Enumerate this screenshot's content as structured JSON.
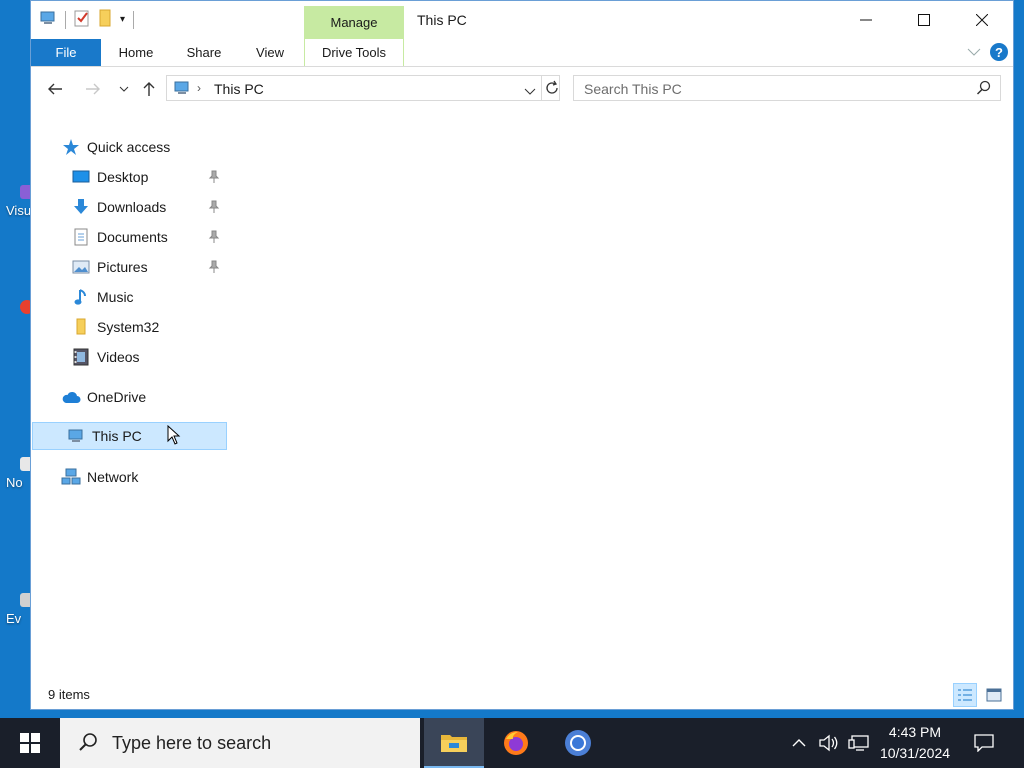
{
  "desktop": {
    "fragments": [
      {
        "label": "Visu",
        "color": "#8a5fd6"
      },
      {
        "label": "",
        "color": "#e8402e"
      },
      {
        "label": "No",
        "color": "#e8e8e8"
      },
      {
        "label": "Ev",
        "color": "#d0d0d0"
      }
    ]
  },
  "window": {
    "title": "This PC",
    "contextual_tab": "Manage",
    "ribbon_tabs": [
      "File",
      "Home",
      "Share",
      "View",
      "Drive Tools"
    ],
    "address": {
      "crumb": "This PC"
    },
    "search": {
      "placeholder": "Search This PC"
    },
    "nav": {
      "quick_access": "Quick access",
      "items": [
        {
          "label": "Desktop",
          "icon": "desktop-icon",
          "pinned": true
        },
        {
          "label": "Downloads",
          "icon": "downloads-icon",
          "pinned": true
        },
        {
          "label": "Documents",
          "icon": "documents-icon",
          "pinned": true
        },
        {
          "label": "Pictures",
          "icon": "pictures-icon",
          "pinned": true
        },
        {
          "label": "Music",
          "icon": "music-icon",
          "pinned": false
        },
        {
          "label": "System32",
          "icon": "folder-icon",
          "pinned": false
        },
        {
          "label": "Videos",
          "icon": "videos-icon",
          "pinned": false
        }
      ],
      "onedrive": "OneDrive",
      "this_pc": "This PC",
      "network": "Network"
    },
    "status": {
      "items": "9 items"
    }
  },
  "taskbar": {
    "search_placeholder": "Type here to search",
    "time": "4:43 PM",
    "date": "10/31/2024"
  },
  "colors": {
    "accent": "#1979ca",
    "manage_tab": "#c7eaa2",
    "selection": "#cce8ff",
    "taskbar": "#1a1f2a"
  }
}
